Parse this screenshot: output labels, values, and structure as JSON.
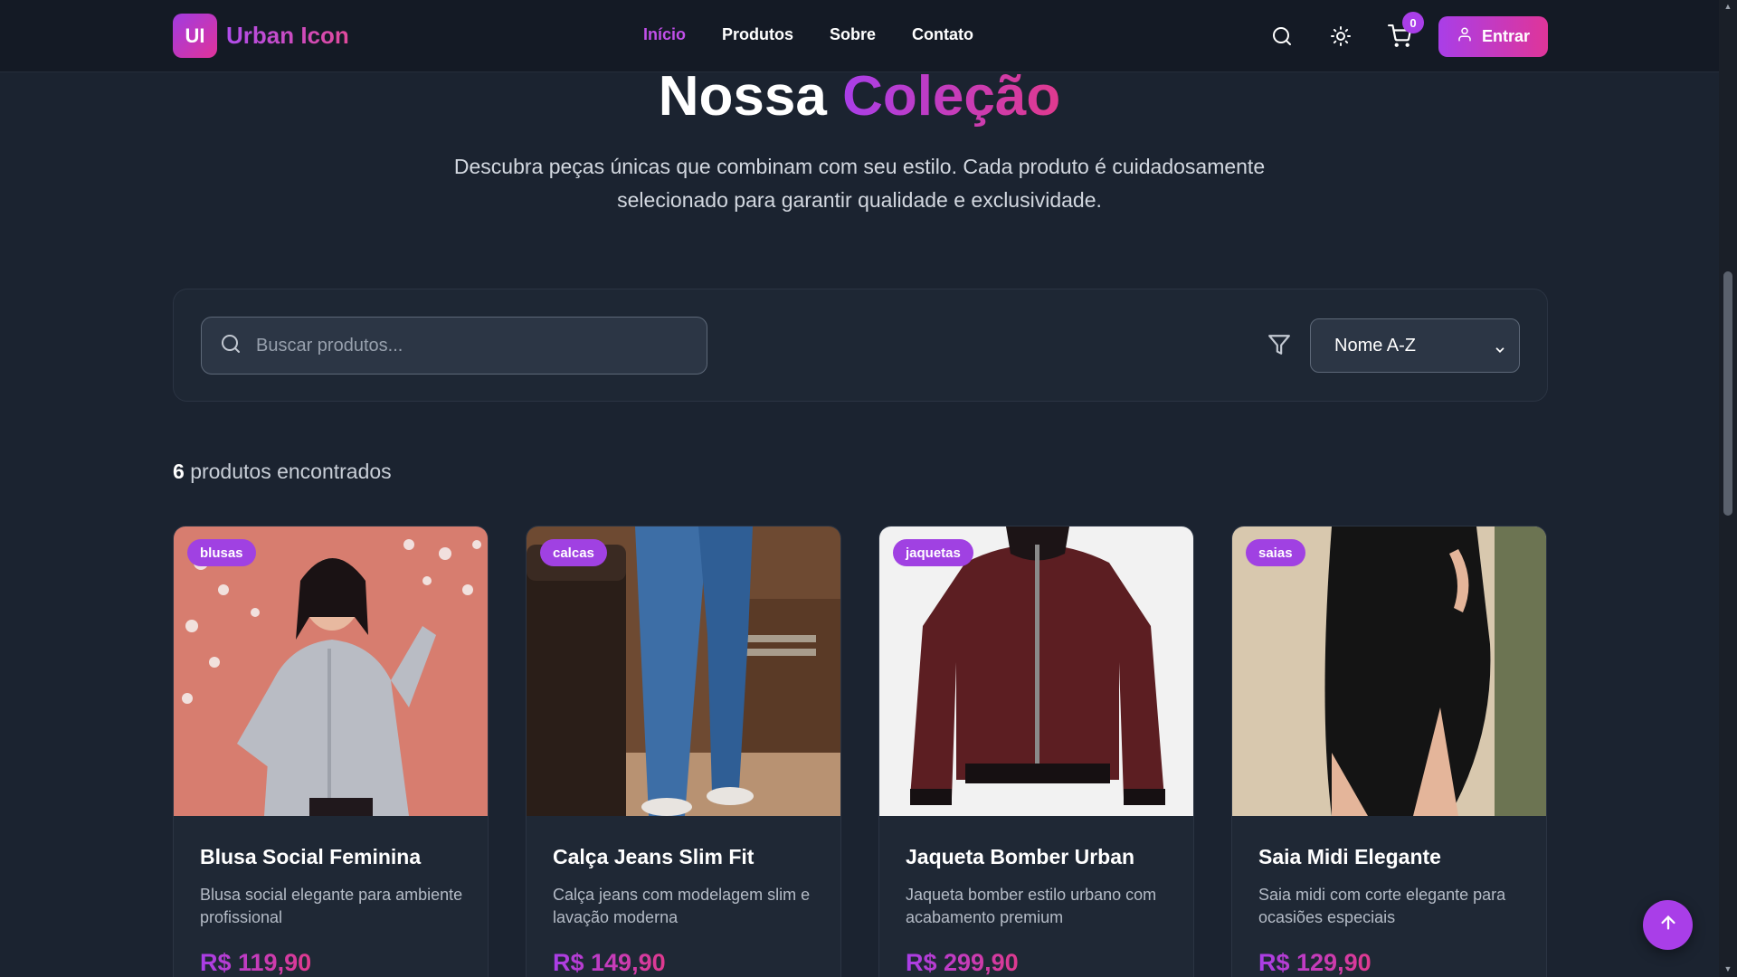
{
  "header": {
    "logo_badge": "UI",
    "logo_text": "Urban Icon",
    "nav": [
      "Início",
      "Produtos",
      "Sobre",
      "Contato"
    ],
    "cart_count": "0",
    "login_label": "Entrar"
  },
  "hero": {
    "title_main": "Nossa",
    "title_accent": "Coleção",
    "subtitle": "Descubra peças únicas que combinam com seu estilo. Cada produto é cuidadosamente selecionado para garantir qualidade e exclusividade."
  },
  "filters": {
    "search_placeholder": "Buscar produtos...",
    "sort_selected": "Nome A-Z"
  },
  "results": {
    "count": "6",
    "label": "produtos encontrados"
  },
  "products": [
    {
      "category": "blusas",
      "name": "Blusa Social Feminina",
      "description": "Blusa social elegante para ambiente profissional",
      "price": "R$ 119,90"
    },
    {
      "category": "calcas",
      "name": "Calça Jeans Slim Fit",
      "description": "Calça jeans com modelagem slim e lavação moderna",
      "price": "R$ 149,90"
    },
    {
      "category": "jaquetas",
      "name": "Jaqueta Bomber Urban",
      "description": "Jaqueta bomber estilo urbano com acabamento premium",
      "price": "R$ 299,90"
    },
    {
      "category": "saias",
      "name": "Saia Midi Elegante",
      "description": "Saia midi com corte elegante para ocasiões especiais",
      "price": "R$ 129,90"
    }
  ],
  "colors": {
    "accent": "#a93ee8",
    "accent_pink": "#e03a8e",
    "background": "#1b2330",
    "header": "#141a25"
  },
  "icons": [
    "search-icon",
    "sun-icon",
    "cart-icon",
    "user-icon",
    "filter-icon",
    "chevron-down-icon",
    "arrow-up-icon"
  ]
}
